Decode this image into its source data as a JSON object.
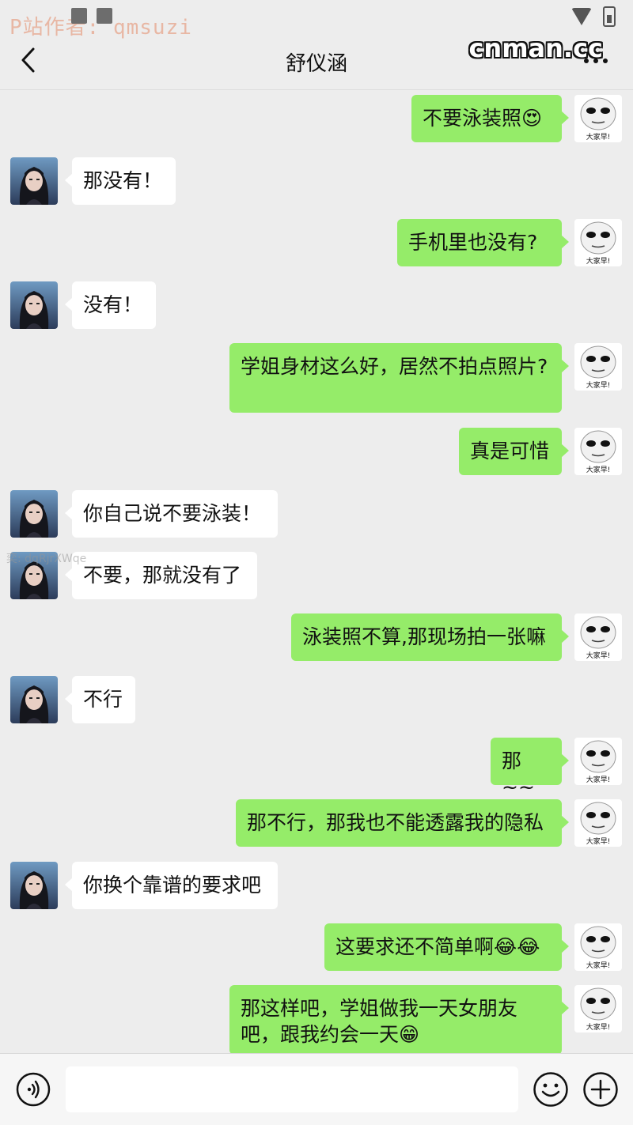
{
  "header": {
    "watermark": "P站作者: qmsuzi",
    "title": "舒仪涵",
    "site_mark": "cnman.cc",
    "back_icon": "chevron-left-icon",
    "more_icon": "more-dots-icon"
  },
  "overlay_watermark": "奕: dqRjrXWqe",
  "colors": {
    "background": "#ededed",
    "sent_bubble": "#95ec69",
    "received_bubble": "#ffffff"
  },
  "messages": [
    {
      "side": "right",
      "text": "不要泳装照😍"
    },
    {
      "side": "left",
      "text": "那没有！"
    },
    {
      "side": "right",
      "text": "手机里也没有?"
    },
    {
      "side": "left",
      "text": "没有！"
    },
    {
      "side": "right",
      "text": "学姐身材这么好，居然不拍点照片?"
    },
    {
      "side": "right",
      "text": "真是可惜"
    },
    {
      "side": "left",
      "text": "你自己说不要泳装！"
    },
    {
      "side": "left",
      "text": "不要，那就没有了"
    },
    {
      "side": "right",
      "text": "泳装照不算,那现场拍一张嘛"
    },
    {
      "side": "left",
      "text": "不行"
    },
    {
      "side": "right",
      "text": "那~~"
    },
    {
      "side": "right",
      "text": "那不行，那我也不能透露我的隐私"
    },
    {
      "side": "left",
      "text": "你换个靠谱的要求吧"
    },
    {
      "side": "right",
      "text": "这要求还不简单啊😂😂"
    },
    {
      "side": "right",
      "text": "那这样吧，学姐做我一天女朋友吧，跟我约会一天😁"
    }
  ],
  "sticker_caption": "大家早!",
  "input": {
    "placeholder": "",
    "value": "",
    "voice_icon": "voice-icon",
    "emoji_icon": "emoji-icon",
    "add_icon": "plus-circle-icon"
  }
}
